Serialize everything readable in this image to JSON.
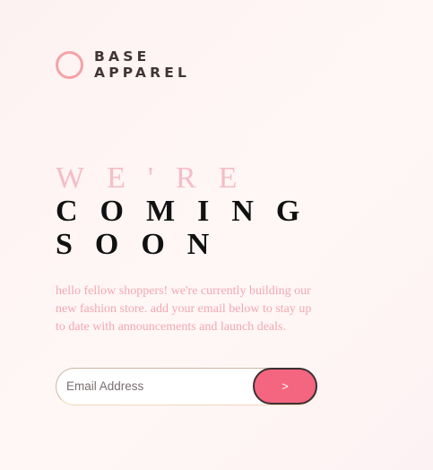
{
  "brand": {
    "line1": "BASE",
    "line2": "APPAREL",
    "ring_color": "#f4a3a8"
  },
  "headline": {
    "line1": "WE'RE",
    "line2": "COMING",
    "line3": "SOON"
  },
  "description": "hello fellow shoppers! we're currently building our new fashion store. add your email below to stay up to date with announcements and launch deals.",
  "form": {
    "email_placeholder": "Email Address",
    "submit_label": ">"
  },
  "colors": {
    "accent": "#f4657f",
    "soft_pink": "#f6bcc4",
    "dark": "#111111"
  }
}
